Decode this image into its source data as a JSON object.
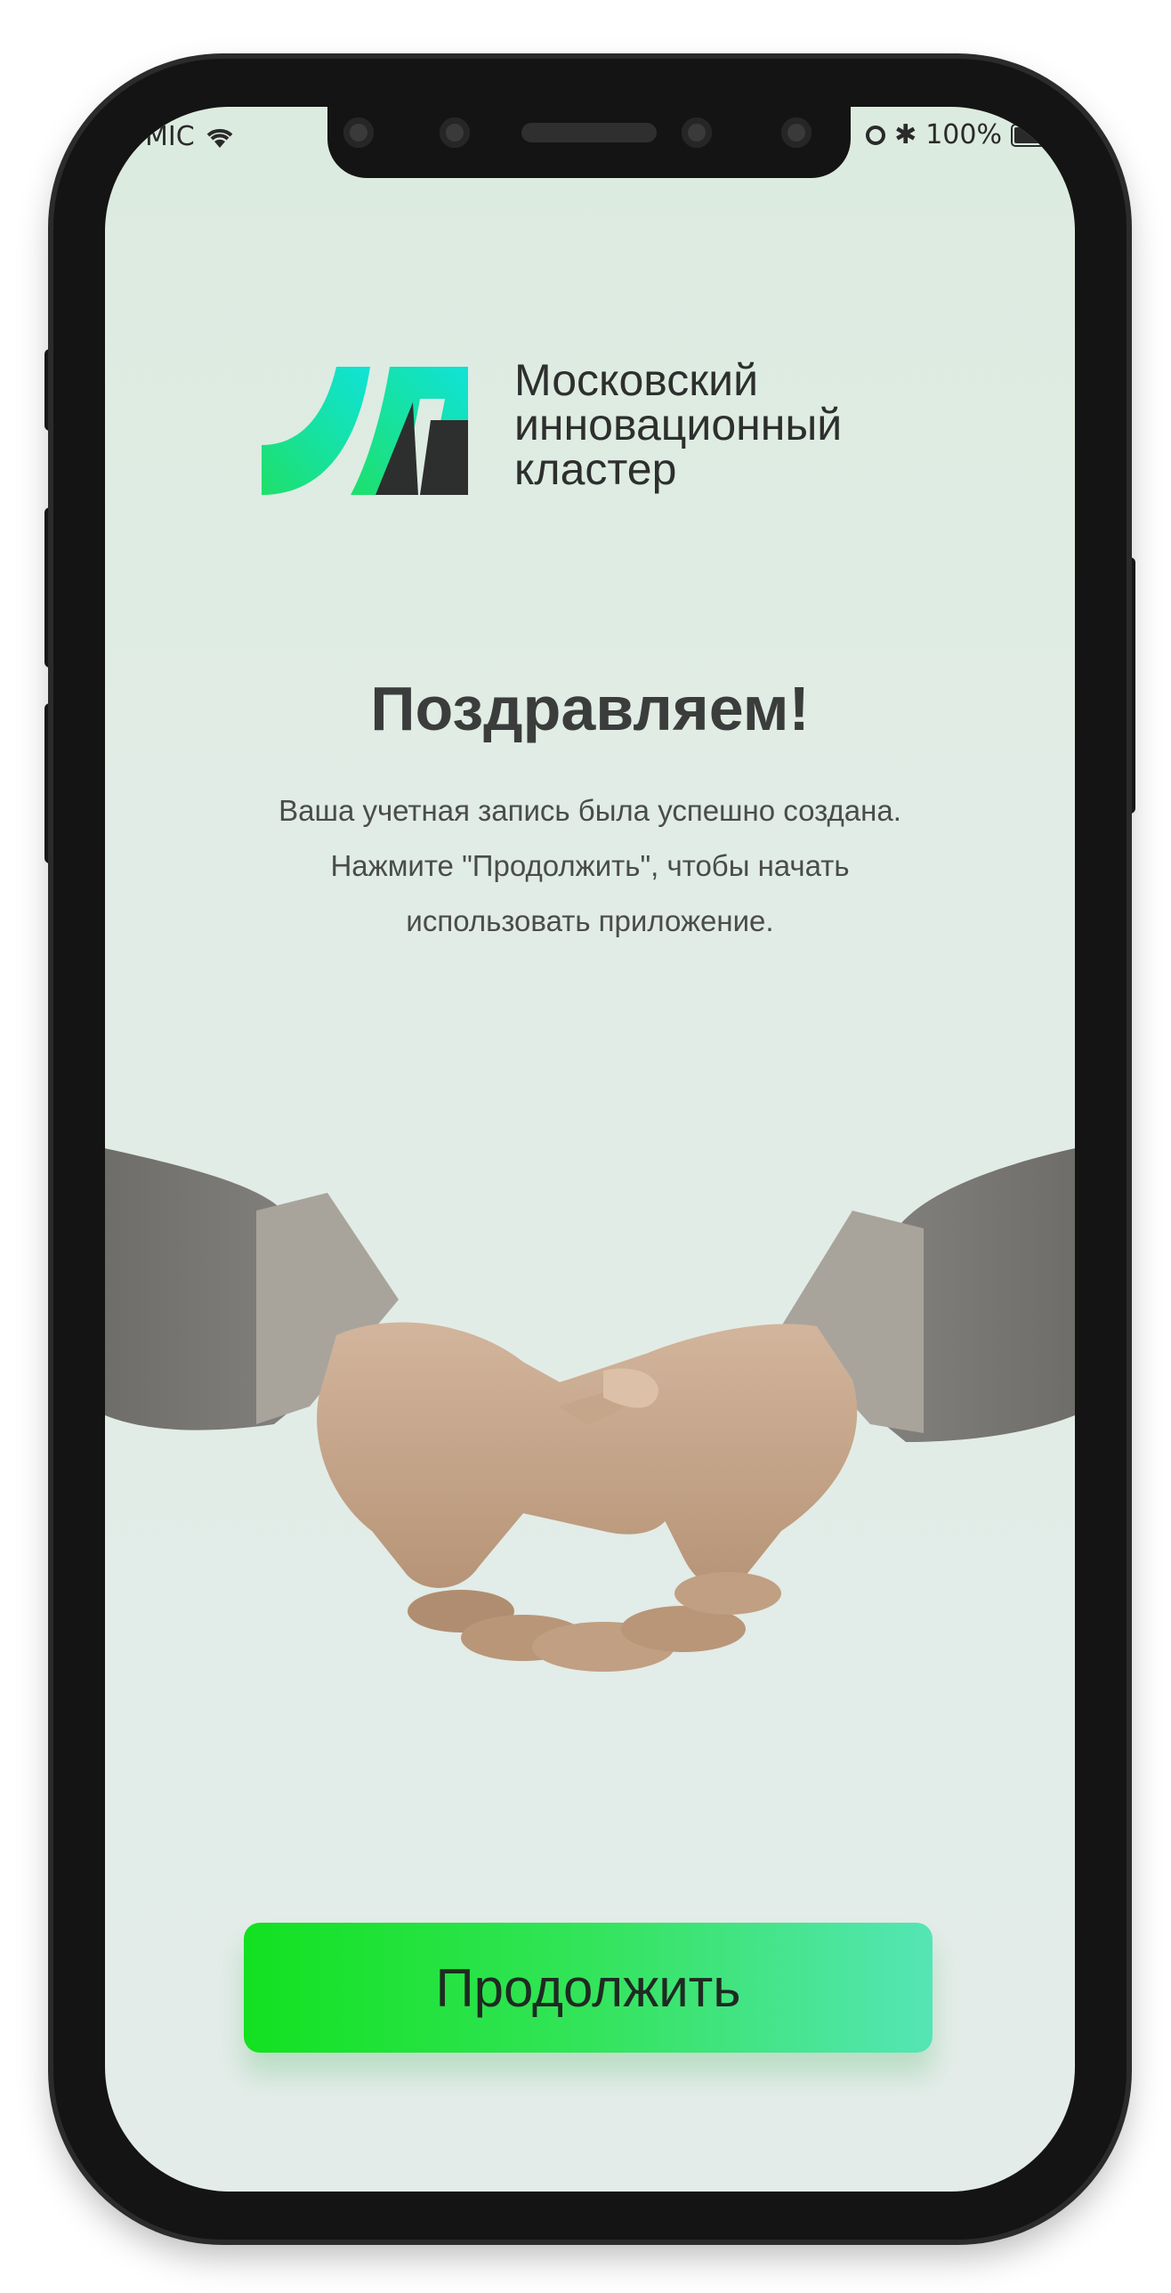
{
  "status_bar": {
    "carrier": "MIC",
    "battery": "100%"
  },
  "logo": {
    "name": "mic-logo",
    "lines": [
      "Московский",
      "инновационный",
      "кластер"
    ],
    "colors": [
      "#1ee06a",
      "#0fe3d8",
      "#2d2f2e"
    ]
  },
  "title": "Поздравляем!",
  "message": {
    "lines": [
      "Ваша учетная запись была успешно создана.",
      "Нажмите \"Продолжить\", чтобы начать",
      "использовать приложение."
    ]
  },
  "illustration": "handshake",
  "continue_button": {
    "label": "Продолжить",
    "colors": [
      "#12e120",
      "#55e5b6"
    ]
  }
}
